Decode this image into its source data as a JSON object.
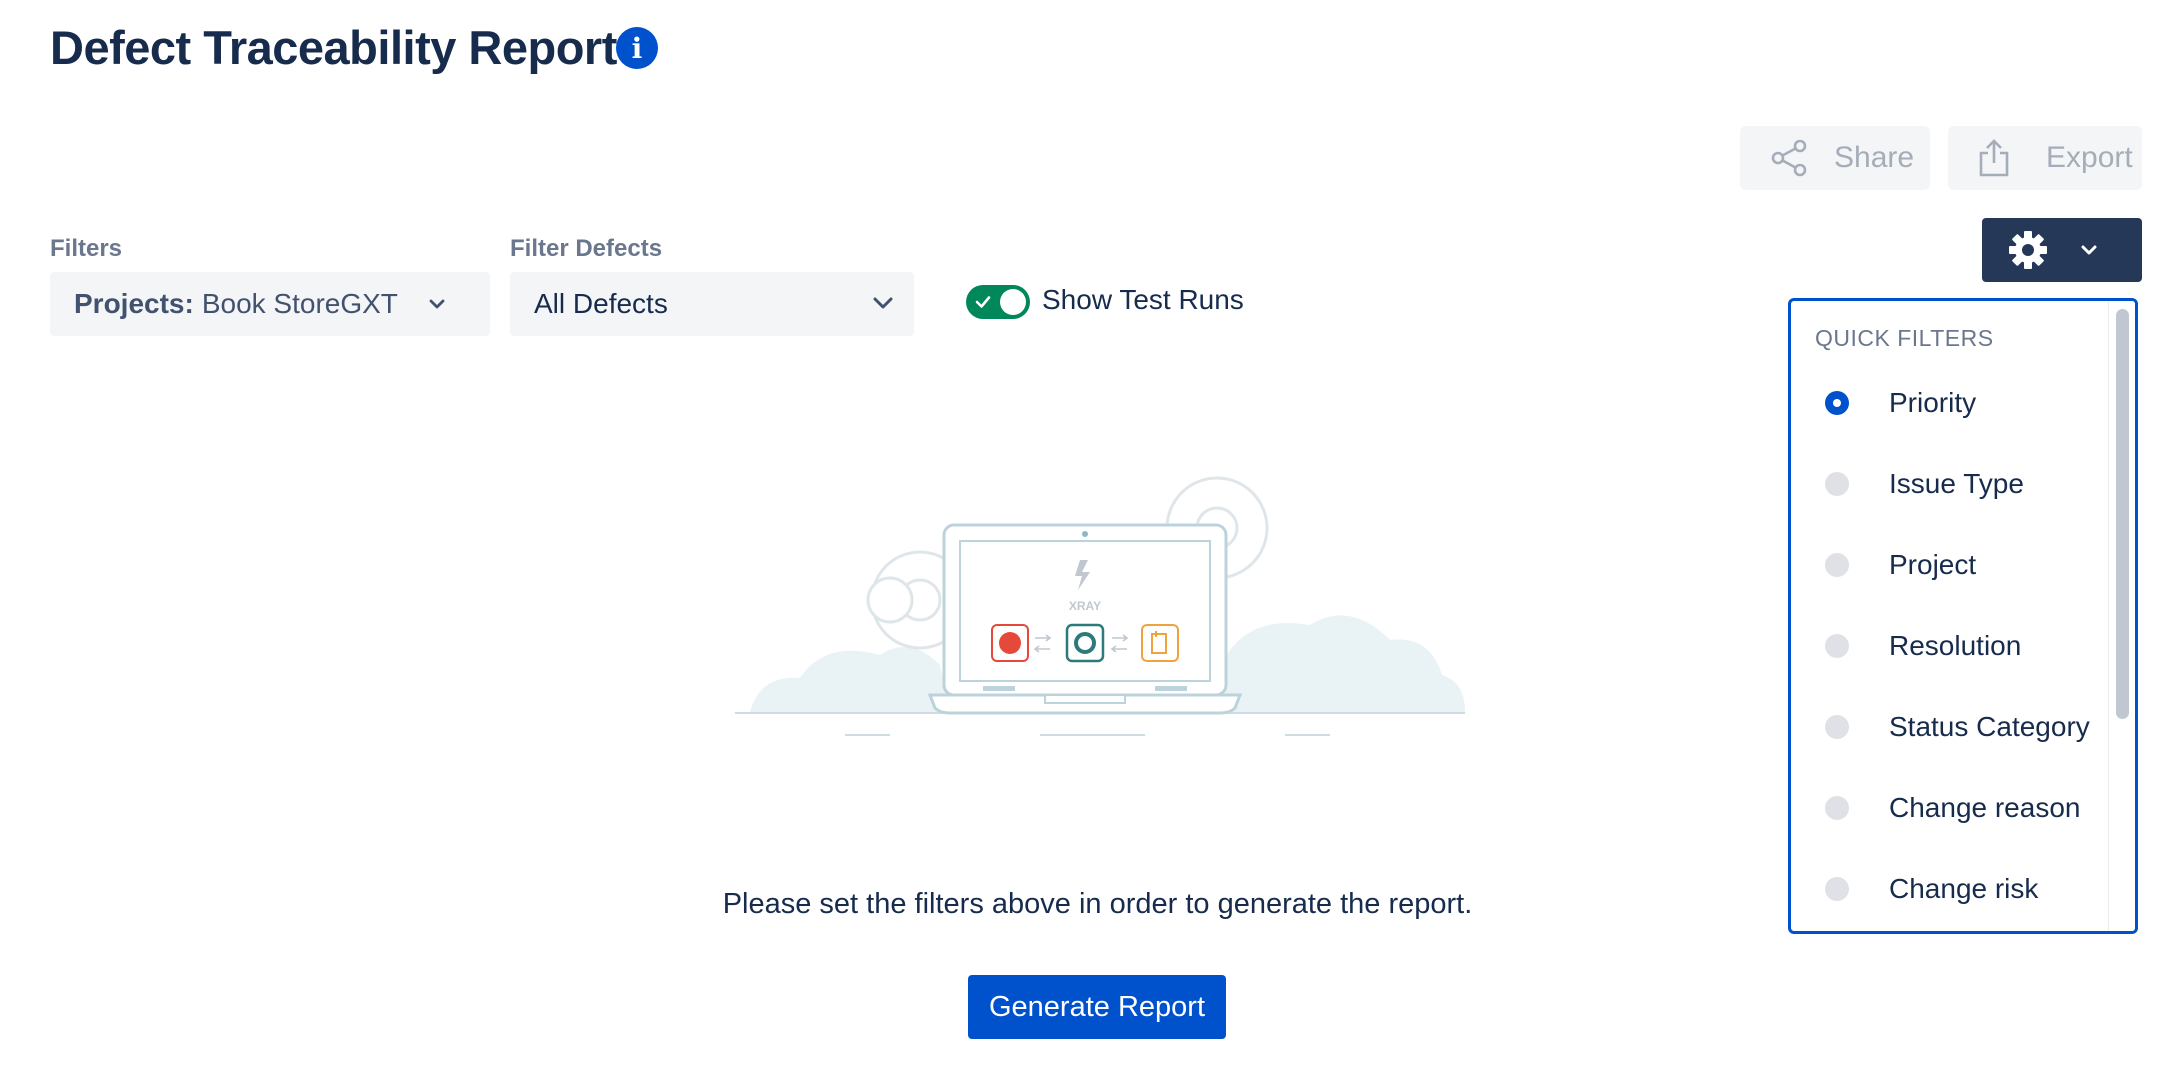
{
  "header": {
    "title": "Defect Traceability Report",
    "info_icon": "info-icon"
  },
  "toolbar": {
    "share_label": "Share",
    "export_label": "Export",
    "settings_icon": "gear-icon"
  },
  "filters": {
    "filters_label": "Filters",
    "projects_key": "Projects:",
    "projects_value": "Book StoreGXT",
    "filter_defects_label": "Filter Defects",
    "filter_defects_value": "All Defects",
    "show_test_runs_label": "Show Test Runs",
    "show_test_runs_on": true
  },
  "quick_filters": {
    "header": "QUICK FILTERS",
    "items": [
      {
        "label": "Priority",
        "selected": true
      },
      {
        "label": "Issue Type",
        "selected": false
      },
      {
        "label": "Project",
        "selected": false
      },
      {
        "label": "Resolution",
        "selected": false
      },
      {
        "label": "Status Category",
        "selected": false
      },
      {
        "label": "Change reason",
        "selected": false
      },
      {
        "label": "Change risk",
        "selected": false
      }
    ]
  },
  "empty_state": {
    "illustration_text": "XRAY",
    "message": "Please set the filters above in order to generate the report.",
    "generate_label": "Generate Report"
  },
  "colors": {
    "primary": "#0052cc",
    "dark": "#253858",
    "toggle_on": "#00875a",
    "text": "#172b4d"
  }
}
